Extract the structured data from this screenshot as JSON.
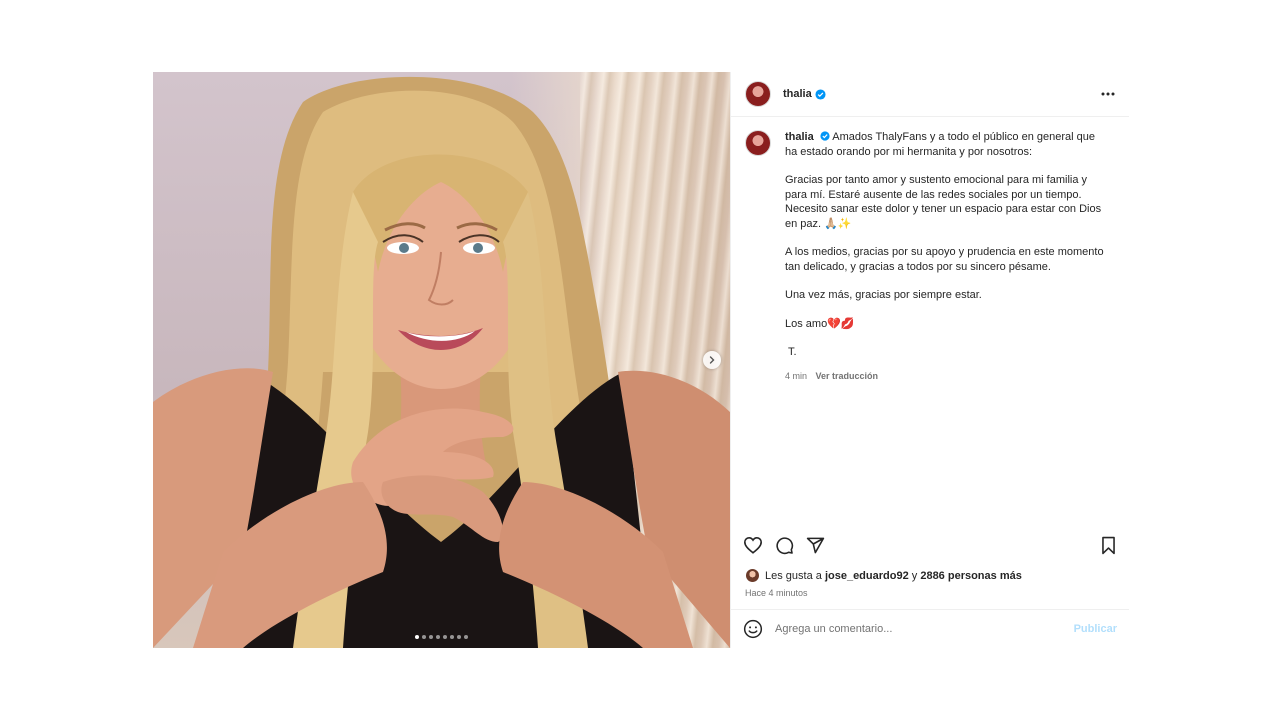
{
  "post": {
    "username": "thalia",
    "verified": true,
    "menu_icon": "more-horizontal-icon",
    "carousel": {
      "total_slides": 8,
      "active_slide": 1,
      "next_icon": "chevron-right-icon"
    }
  },
  "caption": {
    "username": "thalia",
    "lines": [
      "Amados ThalyFans y a todo el público en general que ha estado orando por mi hermanita y por nosotros:",
      "Gracias por tanto amor y sustento emocional para mi familia y para mí. Estaré ausente de las redes sociales por un tiempo. Necesito sanar este dolor y tener un espacio para estar con Dios en paz. 🙏🏼✨",
      "A los medios, gracias por su apoyo y prudencia en este momento tan delicado, y gracias a todos por su sincero pésame.",
      "Una vez más, gracias por siempre estar.",
      "Los amo💔💋",
      "T."
    ],
    "time": "4 min",
    "translate_label": "Ver traducción"
  },
  "actions": {
    "like_icon": "heart-icon",
    "comment_icon": "comment-icon",
    "share_icon": "send-icon",
    "save_icon": "bookmark-icon"
  },
  "likes": {
    "prefix": "Les gusta a ",
    "user": "jose_eduardo92",
    "middle": " y ",
    "others": "2886 personas más"
  },
  "timestamp": "Hace 4 minutos",
  "comment": {
    "emoji_icon": "smiley-icon",
    "placeholder": "Agrega un comentario...",
    "publish_label": "Publicar"
  },
  "colors": {
    "verified": "#0095f6",
    "publish_disabled": "#b2dffc",
    "secondary_text": "#737373"
  }
}
